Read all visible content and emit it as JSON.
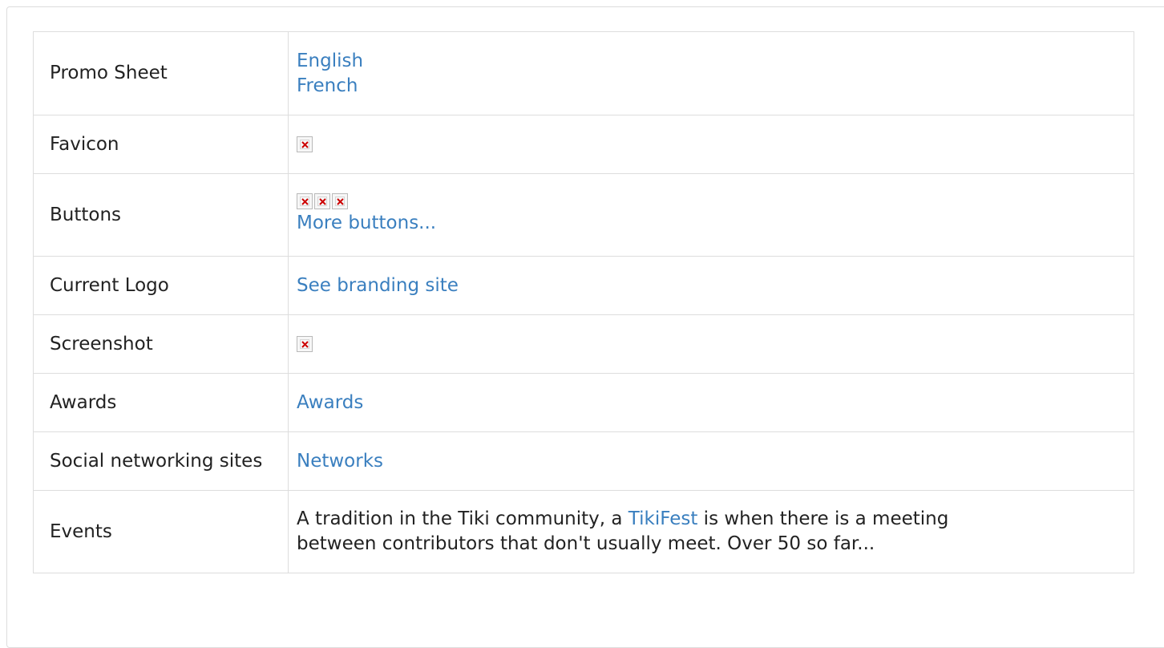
{
  "rows": {
    "promo": {
      "label": "Promo Sheet",
      "links": [
        "English",
        "French"
      ]
    },
    "favicon": {
      "label": "Favicon",
      "image": "broken-image-icon"
    },
    "buttons": {
      "label": "Buttons",
      "images": [
        "broken-image-icon",
        "broken-image-icon",
        "broken-image-icon"
      ],
      "link": "More buttons..."
    },
    "logo": {
      "label": "Current Logo",
      "link": "See branding site"
    },
    "screenshot": {
      "label": "Screenshot",
      "image": "broken-image-icon"
    },
    "awards": {
      "label": "Awards",
      "link": "Awards"
    },
    "social": {
      "label": "Social networking sites",
      "link": "Networks"
    },
    "events": {
      "label": "Events",
      "text_before": "A tradition in the Tiki community, a ",
      "link": "TikiFest",
      "text_after": " is when there is a meeting",
      "text_line2": "between contributors that don't usually meet. Over 50 so far..."
    }
  },
  "colors": {
    "link": "#3a7fbf",
    "border": "#dddddd",
    "broken_x": "#cc0000"
  }
}
